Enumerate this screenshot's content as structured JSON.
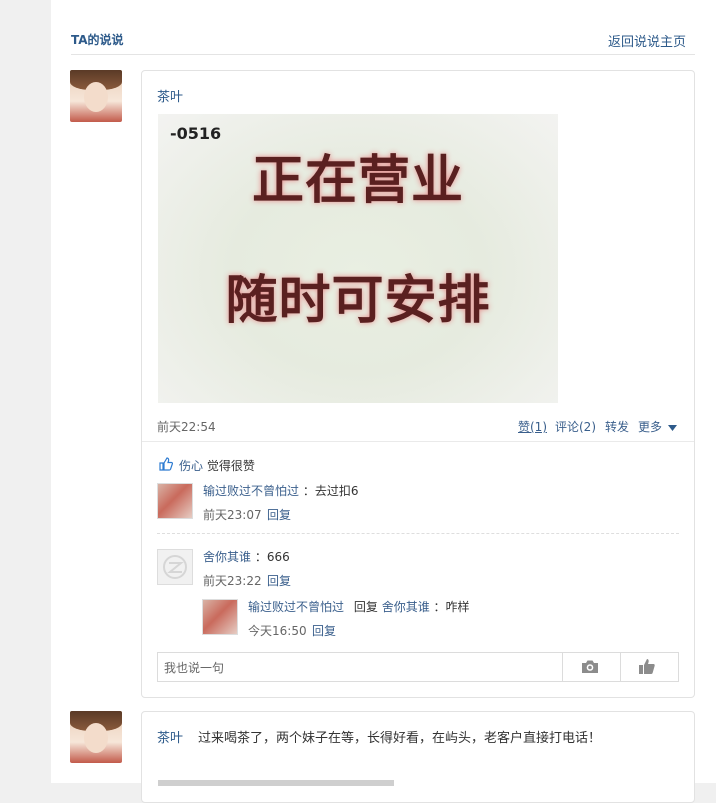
{
  "header": {
    "title": "TA的说说",
    "back_link": "返回说说主页"
  },
  "post1": {
    "author": "茶叶",
    "image_text": {
      "code": "-0516",
      "line1": "正在营业",
      "line2": "随时可安排"
    },
    "time": "前天22:54",
    "actions": {
      "like": "赞(1)",
      "comment": "评论(2)",
      "share": "转发",
      "more": "更多"
    },
    "likes": {
      "user": "伤心",
      "text": "觉得很赞"
    },
    "comments": [
      {
        "user": "输过败过不曾怕过",
        "text": "：去过扣6",
        "time": "前天23:07",
        "reply": "回复"
      },
      {
        "user": "舍你其谁",
        "text": "：666",
        "time": "前天23:22",
        "reply": "回复",
        "replies": [
          {
            "user": "输过败过不曾怕过",
            "reply_word": "回复",
            "target": "舍你其谁",
            "text": "：咋样",
            "time": "今天16:50",
            "reply": "回复"
          }
        ]
      }
    ],
    "input_placeholder": "我也说一句"
  },
  "post2": {
    "author": "茶叶",
    "text": "过来喝茶了，两个妹子在等，长得好看，在屿头，老客户直接打电话！"
  },
  "colors": {
    "link": "#2d5a8a",
    "border": "#e2e2e2",
    "sidebar": "#f0f0f0"
  },
  "icons": [
    "camera-icon",
    "thumbs-up-icon",
    "chevron-down-icon",
    "like-icon",
    "default-avatar-icon"
  ]
}
